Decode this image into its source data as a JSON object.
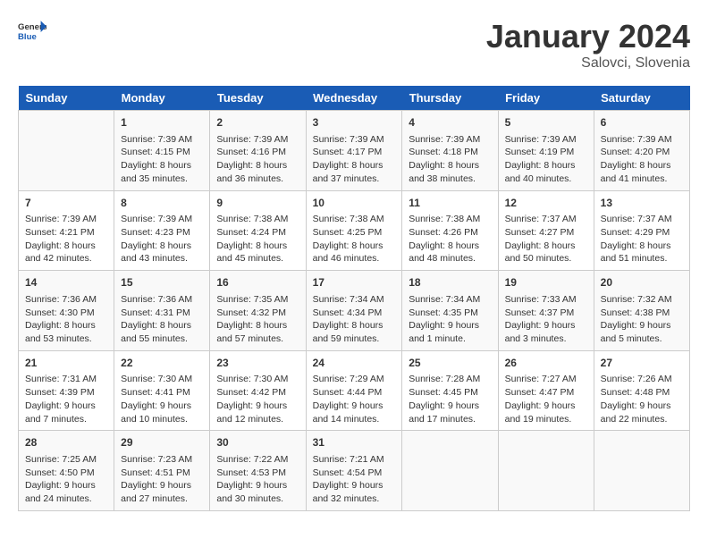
{
  "header": {
    "logo_line1": "General",
    "logo_line2": "Blue",
    "month": "January 2024",
    "location": "Salovci, Slovenia"
  },
  "weekdays": [
    "Sunday",
    "Monday",
    "Tuesday",
    "Wednesday",
    "Thursday",
    "Friday",
    "Saturday"
  ],
  "weeks": [
    [
      {
        "day": "",
        "sunrise": "",
        "sunset": "",
        "daylight": ""
      },
      {
        "day": "1",
        "sunrise": "Sunrise: 7:39 AM",
        "sunset": "Sunset: 4:15 PM",
        "daylight": "Daylight: 8 hours and 35 minutes."
      },
      {
        "day": "2",
        "sunrise": "Sunrise: 7:39 AM",
        "sunset": "Sunset: 4:16 PM",
        "daylight": "Daylight: 8 hours and 36 minutes."
      },
      {
        "day": "3",
        "sunrise": "Sunrise: 7:39 AM",
        "sunset": "Sunset: 4:17 PM",
        "daylight": "Daylight: 8 hours and 37 minutes."
      },
      {
        "day": "4",
        "sunrise": "Sunrise: 7:39 AM",
        "sunset": "Sunset: 4:18 PM",
        "daylight": "Daylight: 8 hours and 38 minutes."
      },
      {
        "day": "5",
        "sunrise": "Sunrise: 7:39 AM",
        "sunset": "Sunset: 4:19 PM",
        "daylight": "Daylight: 8 hours and 40 minutes."
      },
      {
        "day": "6",
        "sunrise": "Sunrise: 7:39 AM",
        "sunset": "Sunset: 4:20 PM",
        "daylight": "Daylight: 8 hours and 41 minutes."
      }
    ],
    [
      {
        "day": "7",
        "sunrise": "Sunrise: 7:39 AM",
        "sunset": "Sunset: 4:21 PM",
        "daylight": "Daylight: 8 hours and 42 minutes."
      },
      {
        "day": "8",
        "sunrise": "Sunrise: 7:39 AM",
        "sunset": "Sunset: 4:23 PM",
        "daylight": "Daylight: 8 hours and 43 minutes."
      },
      {
        "day": "9",
        "sunrise": "Sunrise: 7:38 AM",
        "sunset": "Sunset: 4:24 PM",
        "daylight": "Daylight: 8 hours and 45 minutes."
      },
      {
        "day": "10",
        "sunrise": "Sunrise: 7:38 AM",
        "sunset": "Sunset: 4:25 PM",
        "daylight": "Daylight: 8 hours and 46 minutes."
      },
      {
        "day": "11",
        "sunrise": "Sunrise: 7:38 AM",
        "sunset": "Sunset: 4:26 PM",
        "daylight": "Daylight: 8 hours and 48 minutes."
      },
      {
        "day": "12",
        "sunrise": "Sunrise: 7:37 AM",
        "sunset": "Sunset: 4:27 PM",
        "daylight": "Daylight: 8 hours and 50 minutes."
      },
      {
        "day": "13",
        "sunrise": "Sunrise: 7:37 AM",
        "sunset": "Sunset: 4:29 PM",
        "daylight": "Daylight: 8 hours and 51 minutes."
      }
    ],
    [
      {
        "day": "14",
        "sunrise": "Sunrise: 7:36 AM",
        "sunset": "Sunset: 4:30 PM",
        "daylight": "Daylight: 8 hours and 53 minutes."
      },
      {
        "day": "15",
        "sunrise": "Sunrise: 7:36 AM",
        "sunset": "Sunset: 4:31 PM",
        "daylight": "Daylight: 8 hours and 55 minutes."
      },
      {
        "day": "16",
        "sunrise": "Sunrise: 7:35 AM",
        "sunset": "Sunset: 4:32 PM",
        "daylight": "Daylight: 8 hours and 57 minutes."
      },
      {
        "day": "17",
        "sunrise": "Sunrise: 7:34 AM",
        "sunset": "Sunset: 4:34 PM",
        "daylight": "Daylight: 8 hours and 59 minutes."
      },
      {
        "day": "18",
        "sunrise": "Sunrise: 7:34 AM",
        "sunset": "Sunset: 4:35 PM",
        "daylight": "Daylight: 9 hours and 1 minute."
      },
      {
        "day": "19",
        "sunrise": "Sunrise: 7:33 AM",
        "sunset": "Sunset: 4:37 PM",
        "daylight": "Daylight: 9 hours and 3 minutes."
      },
      {
        "day": "20",
        "sunrise": "Sunrise: 7:32 AM",
        "sunset": "Sunset: 4:38 PM",
        "daylight": "Daylight: 9 hours and 5 minutes."
      }
    ],
    [
      {
        "day": "21",
        "sunrise": "Sunrise: 7:31 AM",
        "sunset": "Sunset: 4:39 PM",
        "daylight": "Daylight: 9 hours and 7 minutes."
      },
      {
        "day": "22",
        "sunrise": "Sunrise: 7:30 AM",
        "sunset": "Sunset: 4:41 PM",
        "daylight": "Daylight: 9 hours and 10 minutes."
      },
      {
        "day": "23",
        "sunrise": "Sunrise: 7:30 AM",
        "sunset": "Sunset: 4:42 PM",
        "daylight": "Daylight: 9 hours and 12 minutes."
      },
      {
        "day": "24",
        "sunrise": "Sunrise: 7:29 AM",
        "sunset": "Sunset: 4:44 PM",
        "daylight": "Daylight: 9 hours and 14 minutes."
      },
      {
        "day": "25",
        "sunrise": "Sunrise: 7:28 AM",
        "sunset": "Sunset: 4:45 PM",
        "daylight": "Daylight: 9 hours and 17 minutes."
      },
      {
        "day": "26",
        "sunrise": "Sunrise: 7:27 AM",
        "sunset": "Sunset: 4:47 PM",
        "daylight": "Daylight: 9 hours and 19 minutes."
      },
      {
        "day": "27",
        "sunrise": "Sunrise: 7:26 AM",
        "sunset": "Sunset: 4:48 PM",
        "daylight": "Daylight: 9 hours and 22 minutes."
      }
    ],
    [
      {
        "day": "28",
        "sunrise": "Sunrise: 7:25 AM",
        "sunset": "Sunset: 4:50 PM",
        "daylight": "Daylight: 9 hours and 24 minutes."
      },
      {
        "day": "29",
        "sunrise": "Sunrise: 7:23 AM",
        "sunset": "Sunset: 4:51 PM",
        "daylight": "Daylight: 9 hours and 27 minutes."
      },
      {
        "day": "30",
        "sunrise": "Sunrise: 7:22 AM",
        "sunset": "Sunset: 4:53 PM",
        "daylight": "Daylight: 9 hours and 30 minutes."
      },
      {
        "day": "31",
        "sunrise": "Sunrise: 7:21 AM",
        "sunset": "Sunset: 4:54 PM",
        "daylight": "Daylight: 9 hours and 32 minutes."
      },
      {
        "day": "",
        "sunrise": "",
        "sunset": "",
        "daylight": ""
      },
      {
        "day": "",
        "sunrise": "",
        "sunset": "",
        "daylight": ""
      },
      {
        "day": "",
        "sunrise": "",
        "sunset": "",
        "daylight": ""
      }
    ]
  ]
}
